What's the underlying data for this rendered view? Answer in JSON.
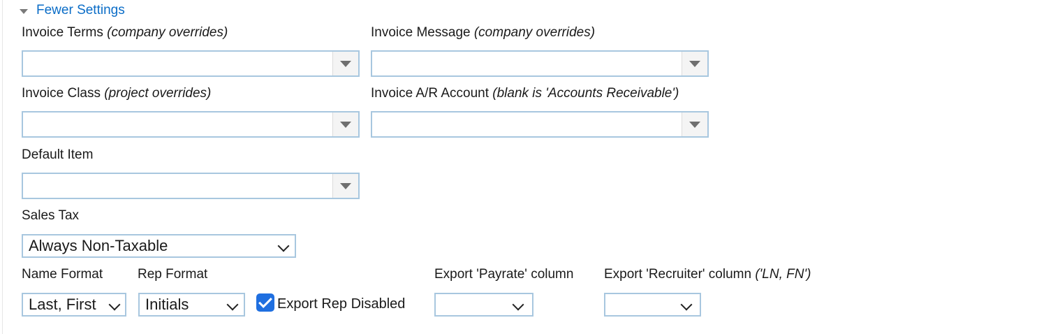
{
  "toggle": {
    "label": "Fewer Settings"
  },
  "fields": {
    "invoice_terms": {
      "label": "Invoice Terms",
      "note": "(company overrides)",
      "value": ""
    },
    "invoice_message": {
      "label": "Invoice Message",
      "note": "(company overrides)",
      "value": ""
    },
    "invoice_class": {
      "label": "Invoice Class",
      "note": "(project overrides)",
      "value": ""
    },
    "invoice_ar_account": {
      "label": "Invoice A/R Account",
      "note": "(blank is 'Accounts Receivable')",
      "value": ""
    },
    "default_item": {
      "label": "Default Item",
      "value": ""
    },
    "sales_tax": {
      "label": "Sales Tax",
      "value": "Always Non-Taxable"
    },
    "name_format": {
      "label": "Name Format",
      "value": "Last, First"
    },
    "rep_format": {
      "label": "Rep Format",
      "value": "Initials"
    },
    "export_rep_disabled": {
      "label": "Export Rep Disabled",
      "checked": true
    },
    "export_payrate": {
      "label": "Export 'Payrate' column",
      "value": ""
    },
    "export_recruiter": {
      "label": "Export 'Recruiter' column",
      "note": "('LN, FN')",
      "value": ""
    }
  },
  "colors": {
    "link": "#0b6dc7",
    "field_border": "#a8c7df",
    "checkbox": "#1f6fe0"
  }
}
